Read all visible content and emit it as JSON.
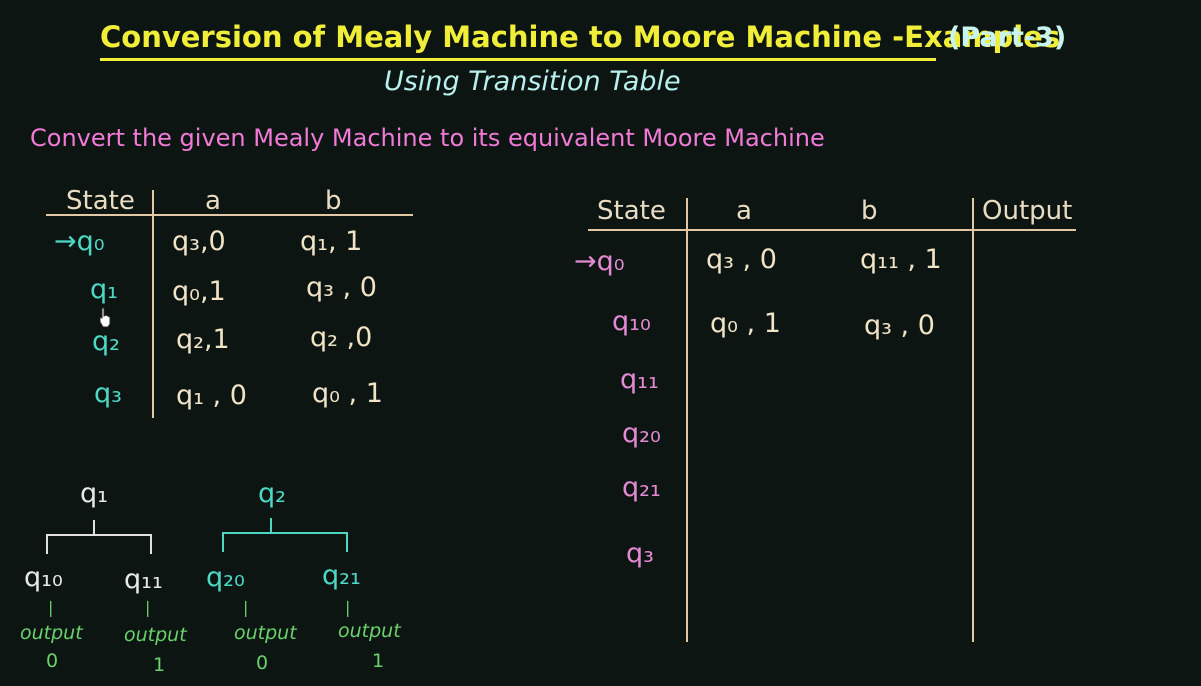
{
  "title": "Conversion of Mealy Machine to Moore Machine -Examples",
  "part": "(Part-3)",
  "subtitle": "Using Transition Table",
  "question": "Convert the given Mealy Machine to its equivalent Moore Machine",
  "mealy_table": {
    "headers": {
      "state": "State",
      "a": "a",
      "b": "b"
    },
    "rows": [
      {
        "state": "→q₀",
        "a": "q₃,0",
        "b": "q₁, 1"
      },
      {
        "state": "q₁",
        "a": "q₀,1",
        "b": "q₃ , 0"
      },
      {
        "state": "q₂",
        "a": "q₂,1",
        "b": "q₂ ,0"
      },
      {
        "state": "q₃",
        "a": "q₁ , 0",
        "b": "q₀ , 1"
      }
    ]
  },
  "moore_table": {
    "headers": {
      "state": "State",
      "a": "a",
      "b": "b",
      "output": "Output"
    },
    "rows": [
      {
        "state": "→q₀",
        "a": "q₃ , 0",
        "b": "q₁₁ , 1",
        "output": ""
      },
      {
        "state": "q₁₀",
        "a": "q₀ , 1",
        "b": "q₃ , 0",
        "output": ""
      },
      {
        "state": "q₁₁",
        "a": "",
        "b": "",
        "output": ""
      },
      {
        "state": "q₂₀",
        "a": "",
        "b": "",
        "output": ""
      },
      {
        "state": "q₂₁",
        "a": "",
        "b": "",
        "output": ""
      },
      {
        "state": "q₃",
        "a": "",
        "b": "",
        "output": ""
      }
    ]
  },
  "split_trees": [
    {
      "root": "q₁",
      "children": [
        {
          "label": "q₁₀",
          "tag": "output",
          "value": "0"
        },
        {
          "label": "q₁₁",
          "tag": "output",
          "value": "1"
        }
      ]
    },
    {
      "root": "q₂",
      "children": [
        {
          "label": "q₂₀",
          "tag": "output",
          "value": "0"
        },
        {
          "label": "q₂₁",
          "tag": "output",
          "value": "1"
        }
      ]
    }
  ]
}
